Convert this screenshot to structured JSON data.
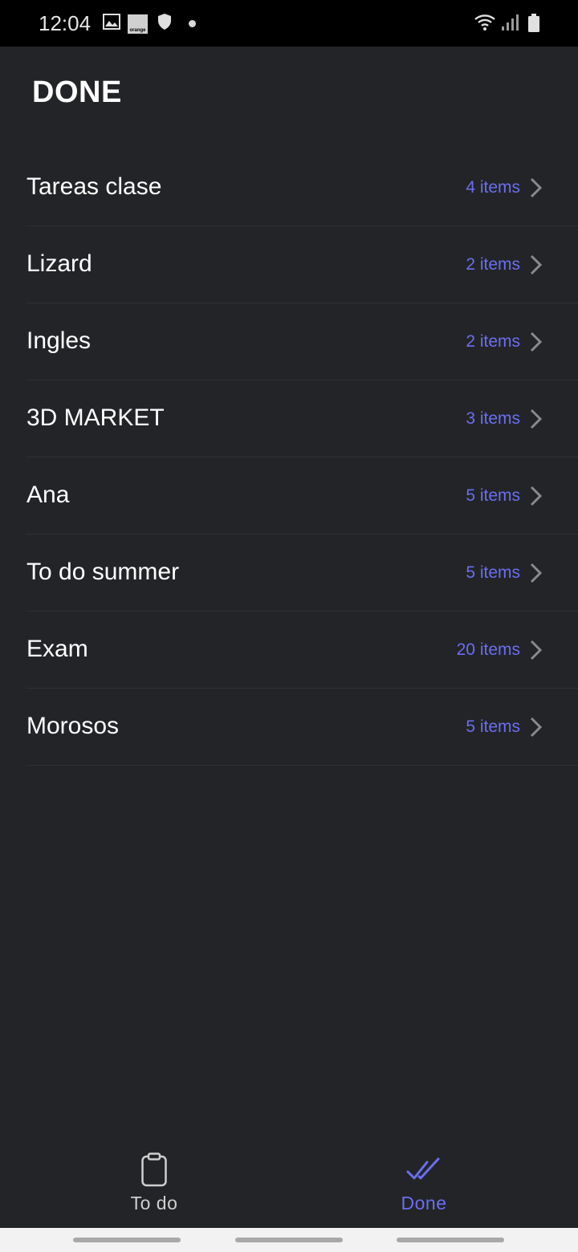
{
  "status_bar": {
    "time": "12:04",
    "carrier_logo_text": "orange",
    "icons": [
      "gallery-icon",
      "carrier-logo",
      "shield-icon",
      "notification-dot",
      "wifi-icon",
      "signal-icon",
      "battery-icon"
    ]
  },
  "page": {
    "title": "DONE"
  },
  "lists": [
    {
      "name": "Tareas clase",
      "count": "4 items"
    },
    {
      "name": "Lizard",
      "count": "2 items"
    },
    {
      "name": "Ingles",
      "count": "2 items"
    },
    {
      "name": "3D MARKET",
      "count": "3 items"
    },
    {
      "name": "Ana",
      "count": "5 items"
    },
    {
      "name": "To do summer",
      "count": "5 items"
    },
    {
      "name": "Exam",
      "count": "20 items"
    },
    {
      "name": "Morosos",
      "count": "5 items"
    }
  ],
  "bottom_nav": {
    "todo_label": "To do",
    "done_label": "Done",
    "active_tab": "Done"
  },
  "colors": {
    "background": "#232428",
    "accent": "#6a6ff0",
    "status_bar": "#000000",
    "divider": "#2f3034"
  }
}
